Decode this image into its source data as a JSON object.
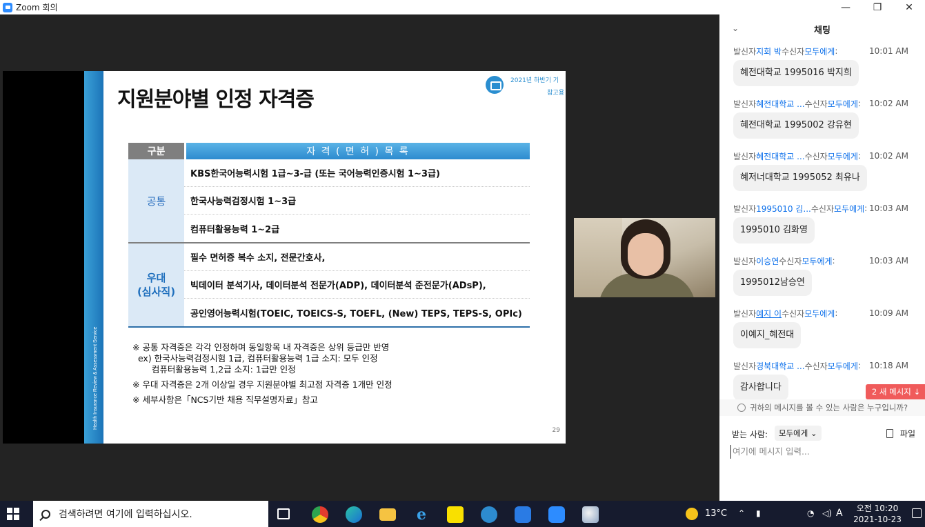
{
  "window": {
    "title": "Zoom 회의",
    "minimize": "—",
    "maximize": "❐",
    "close": "✕"
  },
  "slide": {
    "title": "지원분야별 인정 자격증",
    "badge_line1": "2021년 하반기 기",
    "badge_line2": "참고용",
    "side_text": "Health Insurance Review & Assessment Service",
    "table_header": {
      "col1": "구분",
      "col2": "자 격 ( 면 허 ) 목 록"
    },
    "groups": [
      {
        "label": "공통",
        "rows": [
          "KBS한국어능력시험 1급~3-급 (또는 국어능력인증시험 1~3급)",
          "한국사능력검정시험 1~3급",
          "컴퓨터활용능력 1~2급"
        ]
      },
      {
        "label": "우대\n(심사직)",
        "rows": [
          "필수 면허증 복수 소지, 전문간호사,",
          "빅데이터 분석기사, 데이터분석 전문가(ADP), 데이터분석 준전문가(ADsP),",
          "공인영어능력시험(TOEIC, TOEICS-S, TOEFL, (New) TEPS, TEPS-S, OPIc)"
        ]
      }
    ],
    "notes": [
      "※ 공통 자격증은 각각 인정하며 동일항목 내 자격증은 상위 등급만 반영",
      "  ex) 한국사능력검정시험 1급, 컴퓨터활용능력 1급 소지: 모두 인정",
      "       컴퓨터활용능력 1,2급 소지: 1급만 인정",
      "※ 우대 자격증은 2개 이상일 경우 지원분야별 최고점 자격증 1개만 인정",
      "※ 세부사항은「NCS기반 채용 직무설명자료」참고"
    ],
    "page_number": "29"
  },
  "chat": {
    "title": "채팅",
    "messages": [
      {
        "from_prefix": "발신자",
        "sender": "지회 박",
        "to_prefix": "수신자",
        "recipient": "모두에게",
        "suffix": ":",
        "time": "10:01 AM",
        "text": "혜전대학교 1995016 박지희"
      },
      {
        "from_prefix": "발신자",
        "sender": "혜전대학교 ...",
        "to_prefix": "수신자",
        "recipient": "모두에게",
        "suffix": ":",
        "time": "10:02 AM",
        "text": "혜전대학교 1995002 강유현"
      },
      {
        "from_prefix": "발신자",
        "sender": "혜전대학교 ...",
        "to_prefix": "수신자",
        "recipient": "모두에게",
        "suffix": ":",
        "time": "10:02 AM",
        "text": "혜저너대학교 1995052 최유나"
      },
      {
        "from_prefix": "발신자",
        "sender": "1995010 김...",
        "to_prefix": "수신자",
        "recipient": "모두에게",
        "suffix": ":",
        "time": "10:03 AM",
        "text": "1995010 김화영"
      },
      {
        "from_prefix": "발신자",
        "sender": "이승연",
        "to_prefix": "수신자",
        "recipient": "모두에게",
        "suffix": ":",
        "time": "10:03 AM",
        "text": "1995012남승연"
      },
      {
        "from_prefix": "발신자",
        "sender": "예지 이",
        "to_prefix": "수신자",
        "recipient": "모두에게",
        "suffix": ":",
        "time": "10:09 AM",
        "text": "이예지_혜전대"
      },
      {
        "from_prefix": "발신자",
        "sender": "경북대학교 ...",
        "to_prefix": "수신자",
        "recipient": "모두에게",
        "suffix": ":",
        "time": "10:18 AM",
        "text": "감사합니다"
      }
    ],
    "new_messages": "2 새 메시지 ↓",
    "visibility": "귀하의 메시지를 볼 수 있는 사람은 누구입니까?",
    "to_label": "받는 사람:",
    "to_value": "모두에게 ⌄",
    "file_label": "파일",
    "input_placeholder": "여기에 메시지 입력..."
  },
  "taskbar": {
    "search_placeholder": "검색하려면 여기에 입력하십시오.",
    "temperature": "13°C",
    "ime": "A",
    "time": "오전 10:20",
    "date": "2021-10-23"
  }
}
